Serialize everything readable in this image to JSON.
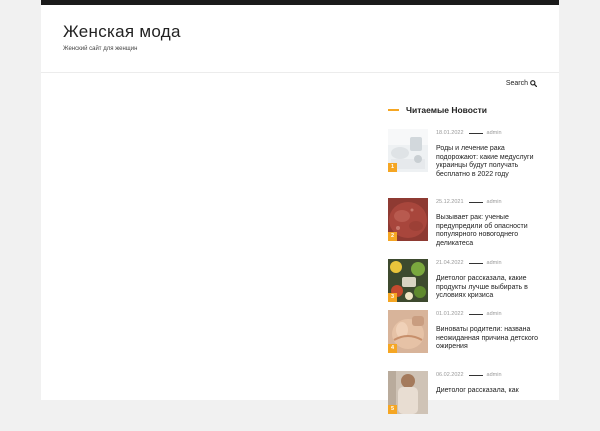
{
  "site": {
    "title": "Женская мода",
    "description": "Женский сайт для женщин"
  },
  "header": {
    "search_label": "Search"
  },
  "colors": {
    "accent": "#f5a623",
    "topbar": "#1b1b1b"
  },
  "widget": {
    "title": "Читаемые Новости",
    "posts": [
      {
        "rank": "1",
        "date": "18.01.2022",
        "author": "admin",
        "title": "Роды и лечение рака подорожают: какие медуслуги украинцы будут получать бесплатно в 2022 году"
      },
      {
        "rank": "2",
        "date": "25.12.2021",
        "author": "admin",
        "title": "Вызывает рак: ученые предупредили об опасности популярного новогоднего деликатеса"
      },
      {
        "rank": "3",
        "date": "21.04.2022",
        "author": "admin",
        "title": "Диетолог рассказала, какие продукты лучше выбирать в условиях кризиса"
      },
      {
        "rank": "4",
        "date": "01.01.2022",
        "author": "admin",
        "title": "Виноваты родители: названа неожиданная причина детского ожирения"
      },
      {
        "rank": "5",
        "date": "06.02.2022",
        "author": "admin",
        "title": "Диетолог рассказала, как"
      }
    ]
  }
}
